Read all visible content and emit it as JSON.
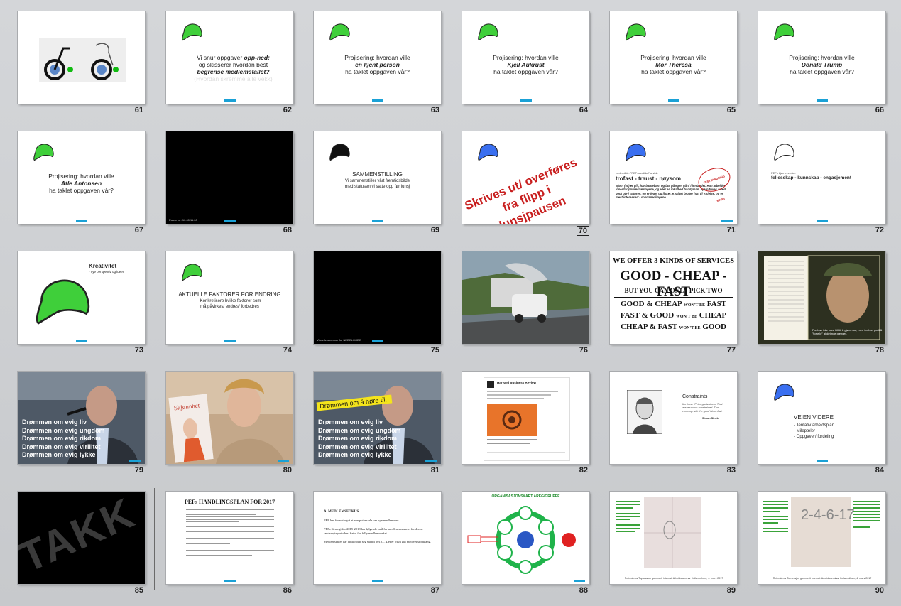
{
  "slides": [
    {
      "num": "61"
    },
    {
      "num": "62",
      "l1": "Vi snur oppgaver ",
      "l1i": "opp-ned:",
      "l2": "og skisserer hvordan best",
      "l3": "begrense medlemstallet?",
      "l4": "(Hvordan skremme alle vekk)"
    },
    {
      "num": "63",
      "l1": "Projisering: hvordan ville",
      "l2": "en kjent person",
      "l3": "ha taklet oppgaven vår?"
    },
    {
      "num": "64",
      "l1": "Projisering: hvordan ville",
      "l2": "Kjell Aukrust",
      "l3": "ha taklet oppgaven vår?"
    },
    {
      "num": "65",
      "l1": "Projisering: hvordan ville",
      "l2": "Mor Theresa",
      "l3": "ha taklet oppgaven vår?"
    },
    {
      "num": "66",
      "l1": "Projisering: hvordan ville",
      "l2": "Donald Trump",
      "l3": "ha taklet oppgaven vår?"
    },
    {
      "num": "67",
      "l1": "Projisering: hvordan ville",
      "l2": "Atle Antonsen",
      "l3": "ha taklet oppgaven vår?"
    },
    {
      "num": "68",
      "foot": "Pause av: 10:00/11:00"
    },
    {
      "num": "69",
      "l1": "SAMMENSTILLING",
      "l2": "Vi sammenstiller vårt fremtidsbilde",
      "l3": "med statusen vi satte opp før lunsj"
    },
    {
      "num": "70",
      "l1": "Skrives ut/ overføres",
      "l2": "fra flipp i lunsjpausen"
    },
    {
      "num": "71",
      "l0": "Lederbilde: \"PEF-kandidat\" a vide",
      "l1": "trofast - traust - nøysom",
      "l2": "Bjørn (65) er gift, har barnebarn og bor på egen gård i innlandet. Han arbeider innenfor primærnæringene, og eller en lokalbed handyman. Bjørn trives svært godt ute i naturen, og er jeger og fisker. Kvalitet bruker han til Yrdelse, og er mest interessert i sportsnedlingene.",
      "stamp": "FESTVANDRING MARS"
    },
    {
      "num": "72",
      "l0": "PEFs kjerneverdier:",
      "l1": "fellesskap - kunnskap - engasjement"
    },
    {
      "num": "73",
      "l1": "Kreativitet",
      "l2": "- nye perspektiv og ideer"
    },
    {
      "num": "74",
      "l1": "AKTUELLE FAKTORER FOR ENDRING",
      "l2": "-Konkretisere hvilke faktorer som",
      "l3": "må påvirkes/ endres/ forbedres"
    },
    {
      "num": "75",
      "foot": "Visuelle stemmer for NEDELOGDE"
    },
    {
      "num": "76"
    },
    {
      "num": "77",
      "l1": "WE OFFER 3 KINDS OF SERVICES",
      "l2": "GOOD - CHEAP - FAST",
      "l3": "BUT YOU CAN ONLY PICK TWO",
      "r1a": "GOOD & CHEAP",
      "r1b": "WON'T BE",
      "r1c": "FAST",
      "r2a": "FAST & GOOD",
      "r2b": "WON'T BE",
      "r2c": "CHEAP",
      "r3a": "CHEAP & FAST",
      "r3b": "WON'T BE",
      "r3c": "GOOD"
    },
    {
      "num": "78",
      "cap": "For han ikke bare kill til å gjøre noe, men for han godt å \"fortelle\" gi det noe gjenger."
    },
    {
      "num": "79",
      "lines": [
        "Drømmen om evig liv",
        "Drømmen om evig ungdom",
        "Drømmen om evig rikdom",
        "Drømmen om evig virilitet",
        "Drømmen om evig lykke"
      ]
    },
    {
      "num": "80"
    },
    {
      "num": "81",
      "banner": "Drømmen om å høre til..",
      "lines": [
        "Drømmen om evig liv",
        "Drømmen om evig ungdom",
        "Drømmen om evig rikdom",
        "Drømmen om evig virilitet",
        "Drømmen om evig lykke"
      ]
    },
    {
      "num": "82",
      "brand": "Harvard Business Review"
    },
    {
      "num": "83",
      "l1": "Constraints",
      "l2": "It's those \"Pet organizations. That are resource-constrained. That come up with the good ideas fast.",
      "l3": "Simon Sinek"
    },
    {
      "num": "84",
      "l1": "VEIEN VIDERE",
      "b1": "- Tentativ arbeidsplan",
      "b2": "- Milepæler",
      "b3": "- Oppgaver/ fordeling"
    },
    {
      "num": "85",
      "l1": "TAKK"
    },
    {
      "num": "86",
      "l1": "PEFs HANDLINGSPLAN FOR 2017"
    },
    {
      "num": "87",
      "l1": "A. MEDLEMSFOKUS",
      "l2": "PEF   har formet også et ene potensiale om nye medlemmer...",
      "l3": "PEFs Strategi for 2015-2018 har følgende mål for medlemsmassen: for denne landsmøteperioden: Satse for felly medlemsvekst.",
      "l4": "Medlemstallet har hittil holdt seg stabilt 2018.... Det er frivil økt med vekstomgang."
    },
    {
      "num": "88",
      "l1": "ORGANISASJONSKART AREG/GRUPPE"
    },
    {
      "num": "89",
      "foot": "Referato av Tsynessjon gummerit internat. Arbeidsseminar Hollæredhum, 4. mars 2017"
    },
    {
      "num": "90",
      "foot": "Referato av Tsynessjon gummerit internat. Arbeidsseminar Hollæredhum, 4. mars 2017",
      "cal": "2-4-6-17"
    }
  ]
}
